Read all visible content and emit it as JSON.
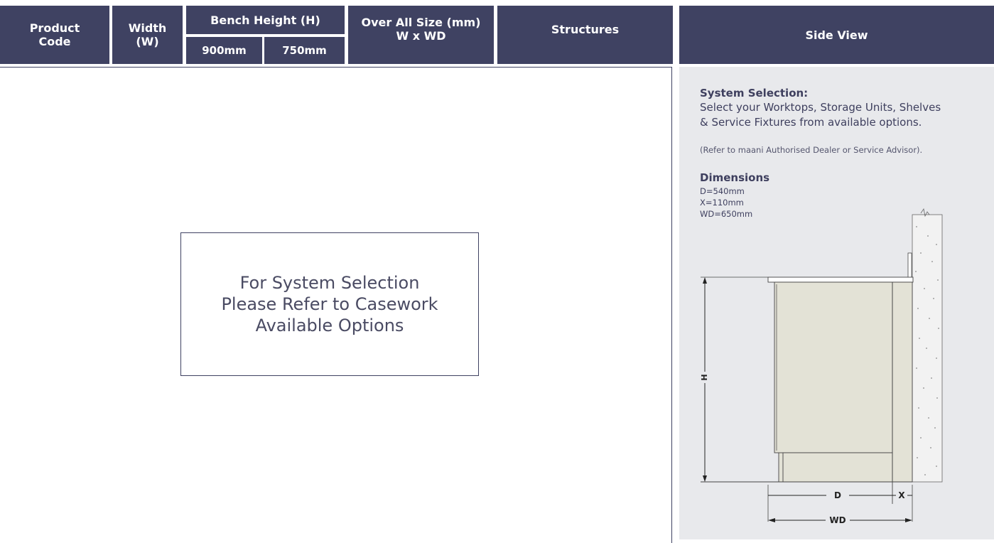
{
  "header": {
    "product_code": [
      "Product",
      "Code"
    ],
    "width": [
      "Width",
      "(W)"
    ],
    "bench_height": "Bench Height (H)",
    "height_900": "900mm",
    "height_750": "750mm",
    "overall_size": [
      "Over All Size (mm)",
      "W x WD"
    ],
    "structures": "Structures",
    "side_view": "Side View"
  },
  "notice": {
    "lines": [
      "For System Selection",
      "Please Refer to Casework",
      "Available Options"
    ]
  },
  "side_panel": {
    "title": "System Selection:",
    "text_lines": [
      "Select your Worktops, Storage Units, Shelves",
      "& Service Fixtures from available options."
    ],
    "note": "(Refer to maani Authorised Dealer or Service Advisor).",
    "dimensions_title": "Dimensions",
    "dimensions": [
      "D=540mm",
      "X=110mm",
      "WD=650mm"
    ]
  },
  "diagram": {
    "label_h": "H",
    "label_d": "D",
    "label_x": "X",
    "label_wd": "WD"
  },
  "colors": {
    "header_bg": "#3f4262",
    "panel_bg": "#e8e9ec",
    "cabinet_fill": "#e3e2d6"
  }
}
